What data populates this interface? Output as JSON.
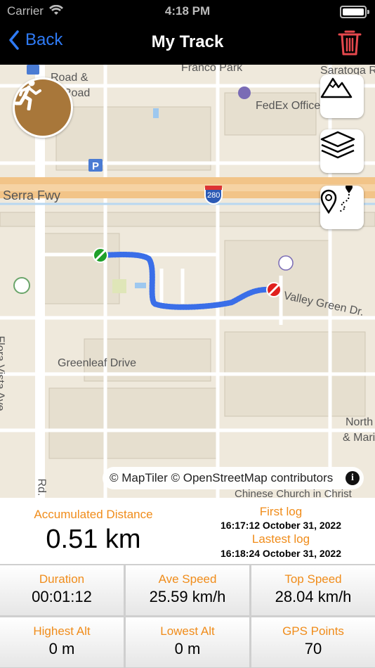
{
  "status_bar": {
    "carrier": "Carrier",
    "time": "4:18 PM"
  },
  "nav": {
    "back_label": "Back",
    "title": "My Track"
  },
  "map": {
    "labels": {
      "franco_park": "Franco Park",
      "saratoga": "Saratoga Road",
      "fedex": "FedEx Office",
      "serra_fwy": "Serra Fwy",
      "hwy": "280",
      "valley_green": "Valley Green Dr.",
      "greenleaf": "Greenleaf Drive",
      "flora_vista": "Flora Vista Ave",
      "north_de_anza": "North De A",
      "and_maria": "& Maria",
      "chinese_church": "Chinese Church in Christ",
      "rd": "Rd.",
      "road_frag1": "Road &",
      "road_frag2": "Road"
    },
    "attribution": "© MapTiler © OpenStreetMap contributors",
    "info_glyph": "i",
    "controls": [
      "terrain-icon",
      "layers-icon",
      "route-icon"
    ]
  },
  "summary": {
    "accum_label": "Accumulated Distance",
    "accum_value": "0.51 km",
    "first_log_label": "First log",
    "first_log_value": "16:17:12 October 31, 2022",
    "last_log_label": "Lastest log",
    "last_log_value": "16:18:24 October 31, 2022"
  },
  "stats": {
    "duration_label": "Duration",
    "duration_value": "00:01:12",
    "ave_speed_label": "Ave Speed",
    "ave_speed_value": "25.59 km/h",
    "top_speed_label": "Top Speed",
    "top_speed_value": "28.04 km/h",
    "highest_alt_label": "Highest Alt",
    "highest_alt_value": "0 m",
    "lowest_alt_label": "Lowest Alt",
    "lowest_alt_value": "0 m",
    "gps_points_label": "GPS Points",
    "gps_points_value": "70"
  },
  "colors": {
    "accent": "#f08c1a",
    "link": "#2f7bf6",
    "trash": "#e5484d",
    "track": "#3a6ee8"
  }
}
